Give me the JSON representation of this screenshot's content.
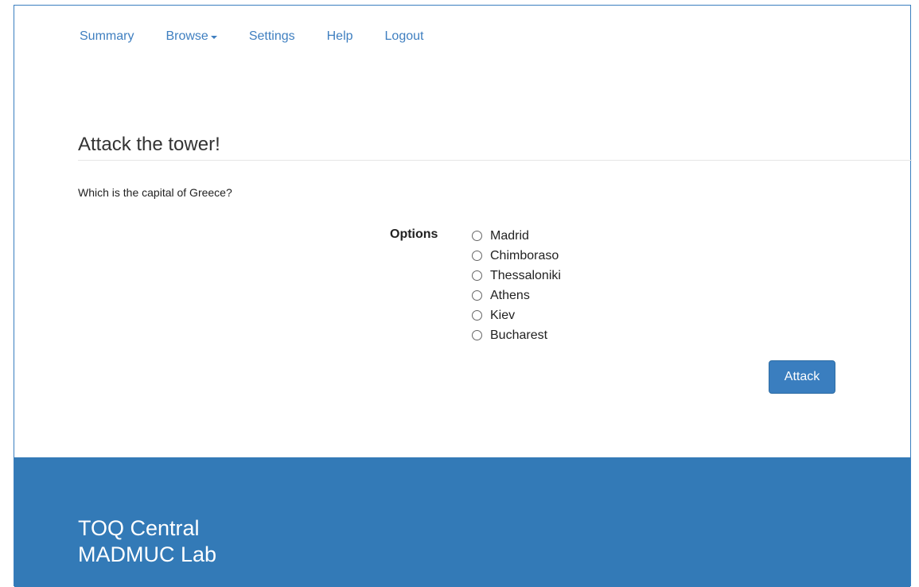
{
  "nav": {
    "items": [
      {
        "label": "Summary"
      },
      {
        "label": "Browse",
        "dropdown": true
      },
      {
        "label": "Settings"
      },
      {
        "label": "Help"
      },
      {
        "label": "Logout"
      }
    ]
  },
  "main": {
    "title": "Attack the tower!",
    "question": "Which is the capital of Greece?",
    "options_label": "Options",
    "options": [
      {
        "label": "Madrid",
        "selected": false
      },
      {
        "label": "Chimboraso",
        "selected": false
      },
      {
        "label": "Thessaloniki",
        "selected": false
      },
      {
        "label": "Athens",
        "selected": false
      },
      {
        "label": "Kiev",
        "selected": false
      },
      {
        "label": "Bucharest",
        "selected": false
      }
    ],
    "submit_label": "Attack"
  },
  "footer": {
    "line1": "TOQ Central",
    "line2": "MADMUC Lab"
  },
  "colors": {
    "accent": "#337ab7",
    "link": "#3f7fc0"
  }
}
